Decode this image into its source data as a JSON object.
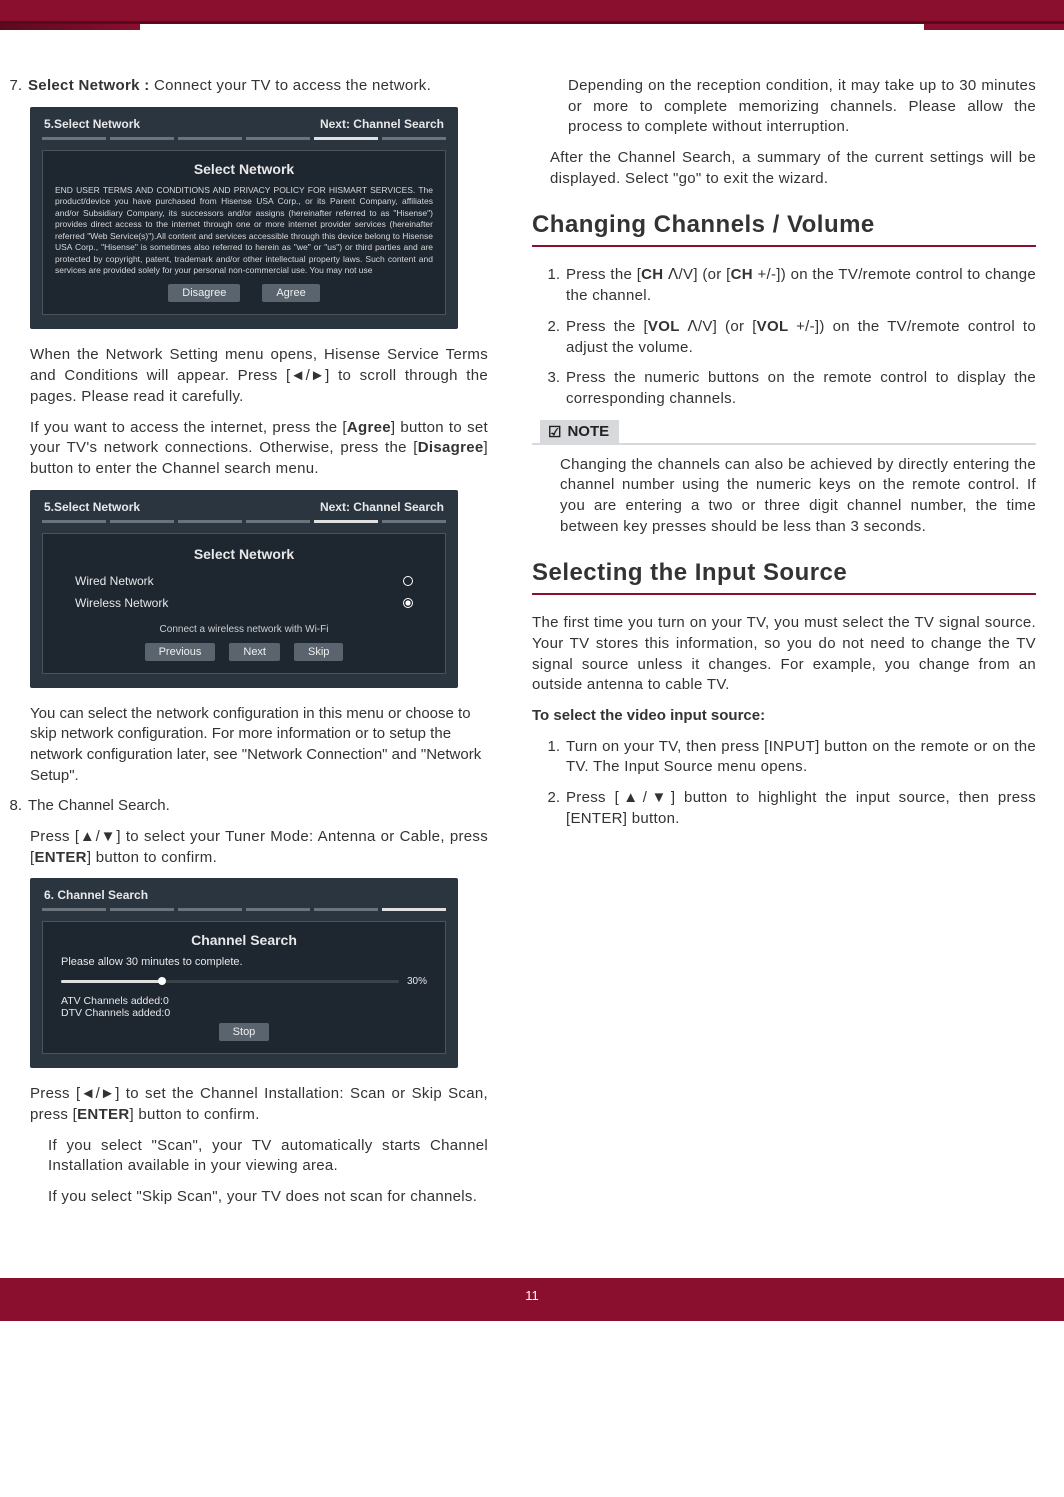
{
  "page_number": "11",
  "left": {
    "item7": {
      "num": "7.",
      "lead_strong": "Select Network : ",
      "lead_rest": "Connect your TV to access the network."
    },
    "panel1": {
      "head_left": "5.Select Network",
      "head_right": "Next: Channel Search",
      "title": "Select Network",
      "eula": "END USER TERMS AND CONDITIONS AND PRIVACY POLICY FOR HISMART SERVICES. The product/device you have purchased from Hisense USA Corp., or its Parent Company, affiliates and/or Subsidiary Company, its successors and/or assigns (hereinafter referred to as \"Hisense\") provides direct access to the internet through one or more internet provider services (hereinafter referred \"Web Service(s)\").All content and services accessible through this device belong to Hisense USA Corp., \"Hisense\" is sometimes also referred to herein as \"we\" or \"us\") or third parties and are protected by copyright, patent, trademark and/or other intellectual property laws. Such content and services are provided solely for your personal non-commercial use. You may not use",
      "btn_disagree": "Disagree",
      "btn_agree": "Agree"
    },
    "p1": "When the Network Setting menu opens, Hisense Service Terms and Conditions will appear. Press [◄/►] to scroll through the pages. Please read it carefully.",
    "p2_a": "If you want to access the internet, press the [",
    "p2_agree": "Agree",
    "p2_b": "] button to set your TV's network connections. Otherwise, press the [",
    "p2_disagree": "Disagree",
    "p2_c": "] button to enter the Channel search menu.",
    "panel2": {
      "head_left": "5.Select Network",
      "head_right": "Next: Channel Search",
      "title": "Select Network",
      "opt_wired": "Wired Network",
      "opt_wireless": "Wireless Network",
      "hint": "Connect a wireless network with Wi-Fi",
      "btn_prev": "Previous",
      "btn_next": "Next",
      "btn_skip": "Skip"
    },
    "p3": "You can select the network configuration in this menu or choose to skip network configuration. For more information or to setup the network configuration later, see \"Network Connection\" and \"Network Setup\".",
    "item8": {
      "num": "8.",
      "text": "The Channel Search."
    },
    "p4_a": "Press [▲/▼] to select your Tuner Mode: Antenna or Cable, press [",
    "p4_enter": "ENTER",
    "p4_b": "] button to confirm.",
    "panel3": {
      "head_left": "6. Channel Search",
      "title": "Channel Search",
      "msg": "Please allow 30 minutes to complete.",
      "pct": "30%",
      "atv": "ATV Channels added:0",
      "dtv": "DTV Channels added:0",
      "btn_stop": "Stop"
    },
    "p5_a": "Press [◄/►] to set the Channel Installation: Scan or Skip Scan, press [",
    "p5_enter": "ENTER",
    "p5_b": "] button to confirm.",
    "p6": "If you select \"Scan\", your TV automatically starts Channel Installation available in your viewing area.",
    "p7": "If you select \"Skip Scan\", your TV does not scan for channels."
  },
  "right": {
    "cont1": "Depending on the reception condition, it may take up to 30 minutes or more to complete memorizing channels. Please allow the process to complete without interruption.",
    "cont2": "After the Channel Search, a summary of the current settings will be displayed.  Select \"go\" to exit the wizard.",
    "sec1_title": "Changing Channels / Volume",
    "sec1_items": {
      "i1_num": "1.",
      "i1_a": "Press the [",
      "i1_ch": "CH ",
      "i1_b": "ᐱ/V] (or [",
      "i1_ch2": "CH ",
      "i1_c": "+/-]) on the TV/remote control to change the channel.",
      "i2_num": "2.",
      "i2_a": "Press the [",
      "i2_vol": "VOL ",
      "i2_b": "ᐱ/V] (or [",
      "i2_vol2": "VOL ",
      "i2_c": "+/-]) on the TV/remote control to adjust the volume.",
      "i3_num": "3.",
      "i3": "Press the numeric buttons on the remote control to display the corresponding channels."
    },
    "note_label": "NOTE",
    "note_text": "Changing the channels can also be achieved by directly entering the channel number using the numeric keys on the remote control. If you are entering a two or three digit channel number, the time between key presses should be less than 3 seconds.",
    "sec2_title": "Selecting the Input Source",
    "sec2_p1": "The first time you turn on your TV, you must select the TV signal source. Your TV stores this information, so you do not need to change the TV signal source unless it changes. For example, you change from an outside antenna to cable TV.",
    "sec2_sub": "To select the video input source:",
    "sec2_items": {
      "i1_num": "1.",
      "i1": "Turn on your TV, then press [INPUT] button on the remote or on the TV. The Input Source menu opens.",
      "i2_num": "2.",
      "i2": "Press [▲/▼] button to highlight the input source, then press [ENTER] button."
    }
  },
  "chart_data": {
    "type": "bar",
    "title": "Channel Search progress",
    "categories": [
      "Progress"
    ],
    "values": [
      30
    ],
    "ylim": [
      0,
      100
    ],
    "ylabel": "%"
  }
}
